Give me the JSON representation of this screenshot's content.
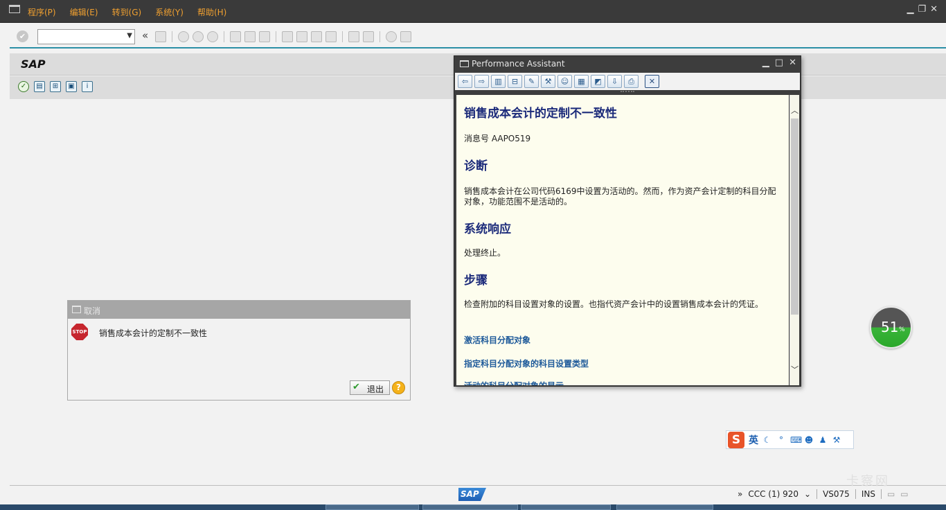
{
  "menu": {
    "items": [
      "程序(P)",
      "编辑(E)",
      "转到(G)",
      "系统(Y)",
      "帮助(H)"
    ]
  },
  "toolbar": {
    "command_field_value": "",
    "back_glyph": "«"
  },
  "screen": {
    "title": "SAP"
  },
  "message_dialog": {
    "title": "取消",
    "stop_label": "STOP",
    "message": "销售成本会计的定制不一致性",
    "exit_label": "退出",
    "help_label": "?"
  },
  "performance_assistant": {
    "title": "Performance Assistant",
    "heading": "销售成本会计的定制不一致性",
    "message_no": "消息号  AAPO519",
    "sections": [
      {
        "heading": "诊断",
        "text": "销售成本会计在公司代码6169中设置为活动的。然而，作为资产会计定制的科目分配对象，功能范围不是活动的。"
      },
      {
        "heading": "系统响应",
        "text": "处理终止。"
      },
      {
        "heading": "步骤",
        "text": "检查附加的科目设置对象的设置。也指代资产会计中的设置销售成本会计的凭证。"
      }
    ],
    "links": [
      "激活科目分配对象",
      "指定科目分配对象的科目设置类型",
      "活动的科目分配对象的显示"
    ]
  },
  "progress": {
    "value": "51",
    "unit": "%"
  },
  "ime": {
    "logo": "S",
    "lang": "英"
  },
  "status_bar": {
    "sap_logo": "SAP",
    "more": "»",
    "system": "CCC (1) 920",
    "server": "VS075",
    "mode": "INS"
  },
  "watermark": "卡察网"
}
